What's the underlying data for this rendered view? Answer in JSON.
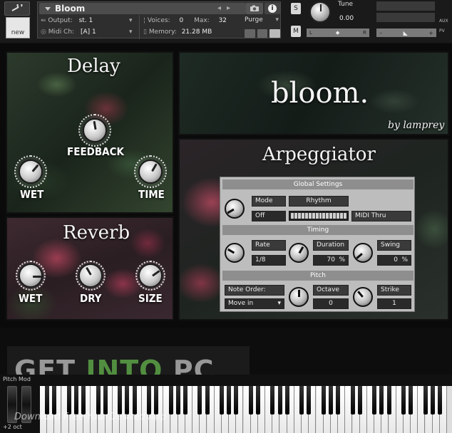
{
  "header": {
    "instrument_name": "Bloom",
    "output_label": "Output:",
    "output_value": "st. 1",
    "midi_label": "Midi Ch:",
    "midi_value": "[A]  1",
    "voices_label": "Voices:",
    "voices_value": "0",
    "max_label": "Max:",
    "max_value": "32",
    "memory_label": "Memory:",
    "memory_value": "21.28 MB",
    "purge_label": "Purge",
    "new_label": "new",
    "solo_label": "S",
    "mute_label": "M",
    "tune_label": "Tune",
    "tune_value": "0.00",
    "pan_left": "L",
    "pan_right": "R",
    "aux_label": "AUX",
    "pv_label": "PV"
  },
  "delay": {
    "title": "Delay",
    "feedback_label": "FEEDBACK",
    "wet_label": "WET",
    "time_label": "TIME"
  },
  "bloom": {
    "title": "bloom.",
    "byline": "by lamprey"
  },
  "reverb": {
    "title": "Reverb",
    "wet_label": "WET",
    "dry_label": "DRY",
    "size_label": "SIZE"
  },
  "arp": {
    "title": "Arpeggiator",
    "global_header": "Global Settings",
    "mode_label": "Mode",
    "mode_value": "Off",
    "rhythm_label": "Rhythm",
    "midi_thru": "MIDI Thru",
    "timing_header": "Timing",
    "rate_label": "Rate",
    "rate_value": "1/8",
    "duration_label": "Duration",
    "duration_value": "70",
    "duration_unit": "%",
    "swing_label": "Swing",
    "swing_value": "0",
    "swing_unit": "%",
    "pitch_header": "Pitch",
    "note_order_label": "Note Order:",
    "note_order_value": "Move in",
    "octave_label": "Octave",
    "octave_value": "0",
    "strike_label": "Strike",
    "strike_value": "1"
  },
  "keyboard": {
    "pitch_mod_label": "Pitch Mod",
    "octave_label": "+2 oct"
  },
  "watermark": {
    "get": "GET ",
    "into": "INTO",
    "pc": " PC",
    "tagline": "Download Free Your Desired App"
  }
}
